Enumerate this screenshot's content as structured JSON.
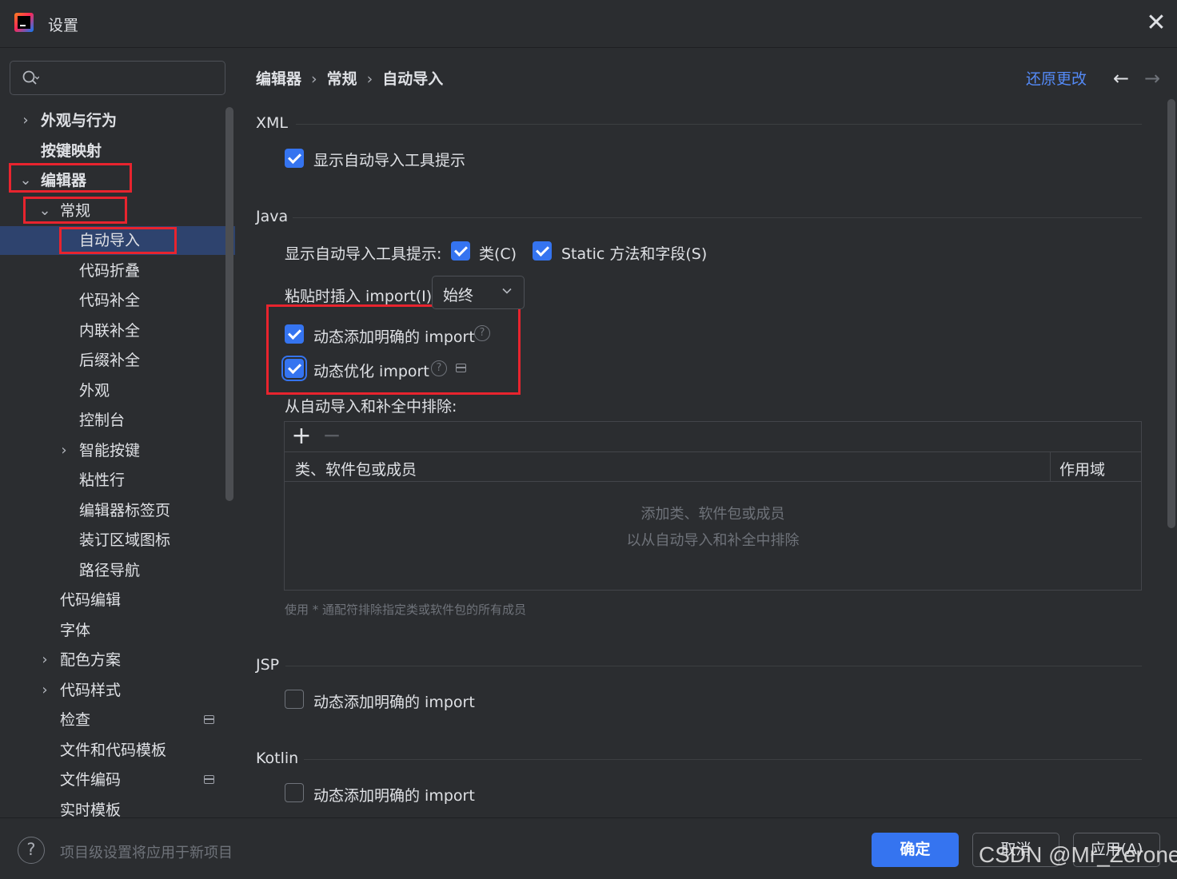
{
  "window": {
    "title": "设置",
    "close_glyph": "✕"
  },
  "search": {
    "placeholder": "",
    "value": ""
  },
  "sidebar": {
    "items": [
      {
        "label": "外观与行为",
        "level": 0,
        "chevron": "›",
        "bold": true
      },
      {
        "label": "按键映射",
        "level": 0,
        "chevron": "",
        "bold": true
      },
      {
        "label": "编辑器",
        "level": 0,
        "chevron": "⌄",
        "bold": true
      },
      {
        "label": "常规",
        "level": 1,
        "chevron": "⌄"
      },
      {
        "label": "自动导入",
        "level": 2,
        "chevron": "",
        "selected": true
      },
      {
        "label": "代码折叠",
        "level": 2,
        "chevron": ""
      },
      {
        "label": "代码补全",
        "level": 2,
        "chevron": ""
      },
      {
        "label": "内联补全",
        "level": 2,
        "chevron": ""
      },
      {
        "label": "后缀补全",
        "level": 2,
        "chevron": ""
      },
      {
        "label": "外观",
        "level": 2,
        "chevron": ""
      },
      {
        "label": "控制台",
        "level": 2,
        "chevron": ""
      },
      {
        "label": "智能按键",
        "level": 2,
        "chevron": "›"
      },
      {
        "label": "粘性行",
        "level": 2,
        "chevron": ""
      },
      {
        "label": "编辑器标签页",
        "level": 2,
        "chevron": ""
      },
      {
        "label": "装订区域图标",
        "level": 2,
        "chevron": ""
      },
      {
        "label": "路径导航",
        "level": 2,
        "chevron": ""
      },
      {
        "label": "代码编辑",
        "level": 1,
        "chevron": ""
      },
      {
        "label": "字体",
        "level": 1,
        "chevron": ""
      },
      {
        "label": "配色方案",
        "level": 1,
        "chevron": "›"
      },
      {
        "label": "代码样式",
        "level": 1,
        "chevron": "›"
      },
      {
        "label": "检查",
        "level": 1,
        "chevron": "",
        "badge": true
      },
      {
        "label": "文件和代码模板",
        "level": 1,
        "chevron": ""
      },
      {
        "label": "文件编码",
        "level": 1,
        "chevron": "",
        "badge": true
      },
      {
        "label": "实时模板",
        "level": 1,
        "chevron": ""
      }
    ]
  },
  "breadcrumb": {
    "items": [
      "编辑器",
      "常规",
      "自动导入"
    ],
    "separator": "›"
  },
  "header": {
    "revert_label": "还原更改",
    "back_glyph": "←",
    "forward_glyph": "→"
  },
  "sections": {
    "xml": {
      "title": "XML",
      "show_tooltip": {
        "label": "显示自动导入工具提示",
        "checked": true
      }
    },
    "java": {
      "title": "Java",
      "tooltip_row_label": "显示自动导入工具提示:",
      "class_option": {
        "label": "类(C)",
        "checked": true
      },
      "static_option": {
        "label": "Static 方法和字段(S)",
        "checked": true
      },
      "paste_label": "粘贴时插入 import(I):",
      "paste_value": "始终",
      "add_unambiguous": {
        "label": "动态添加明确的 import",
        "checked": true
      },
      "optimize_imports": {
        "label": "动态优化 import",
        "checked": true
      },
      "exclude_label": "从自动导入和补全中排除:",
      "exclude_table": {
        "add_glyph": "+",
        "remove_glyph": "−",
        "columns": [
          "类、软件包或成员",
          "作用域"
        ],
        "empty_line1": "添加类、软件包或成员",
        "empty_line2": "以从自动导入和补全中排除"
      },
      "hint": "使用 * 通配符排除指定类或软件包的所有成员"
    },
    "jsp": {
      "title": "JSP",
      "add_unambiguous": {
        "label": "动态添加明确的 import",
        "checked": false
      }
    },
    "kotlin": {
      "title": "Kotlin",
      "add_unambiguous": {
        "label": "动态添加明确的 import",
        "checked": false
      }
    }
  },
  "help_glyph": "?",
  "footer": {
    "help_glyph": "?",
    "note": "项目级设置将应用于新项目",
    "ok_label": "确定",
    "cancel_label": "取消",
    "apply_label": "应用(A)"
  },
  "watermark": "CSDN @Mr_Zerone",
  "colors": {
    "background": "#2b2d30",
    "accent": "#3574f0",
    "selection": "#2e436e",
    "link": "#548af7",
    "annotation_red": "#e8242e"
  }
}
